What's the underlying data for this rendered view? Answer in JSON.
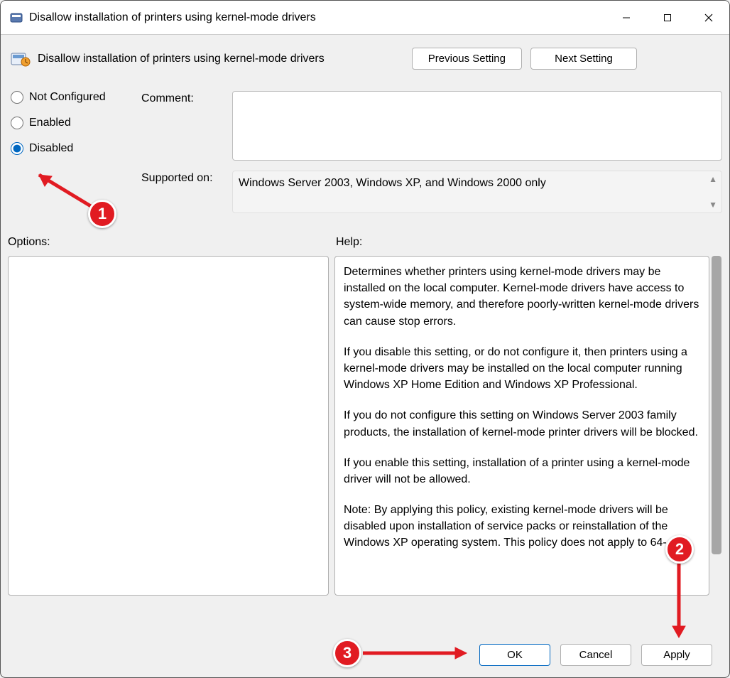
{
  "titlebar": {
    "title": "Disallow installation of printers using kernel-mode drivers"
  },
  "header": {
    "title": "Disallow installation of printers using kernel-mode drivers",
    "prev_label": "Previous Setting",
    "next_label": "Next Setting"
  },
  "radios": {
    "not_configured": "Not Configured",
    "enabled": "Enabled",
    "disabled": "Disabled",
    "selected": "disabled"
  },
  "fields": {
    "comment_label": "Comment:",
    "comment_value": "",
    "supported_label": "Supported on:",
    "supported_value": "Windows Server 2003, Windows XP, and Windows 2000 only"
  },
  "labels": {
    "options": "Options:",
    "help": "Help:"
  },
  "help": {
    "p1": "Determines whether printers using kernel-mode drivers may be installed on the local computer.  Kernel-mode drivers have access to system-wide memory, and therefore poorly-written kernel-mode drivers can cause stop errors.",
    "p2": "If you disable this setting, or do not configure it, then printers using a kernel-mode drivers may be installed on the local computer running Windows XP Home Edition and Windows XP Professional.",
    "p3": "If you do not configure this setting on Windows Server 2003 family products, the installation of kernel-mode printer drivers will be blocked.",
    "p4": "If you enable this setting, installation of a printer using a kernel-mode driver will not be allowed.",
    "p5": "Note: By applying this policy, existing kernel-mode drivers will be disabled upon installation of service packs or reinstallation of the Windows XP operating system. This policy does not apply to 64-"
  },
  "footer": {
    "ok": "OK",
    "cancel": "Cancel",
    "apply": "Apply"
  },
  "annotations": {
    "b1": "1",
    "b2": "2",
    "b3": "3"
  }
}
